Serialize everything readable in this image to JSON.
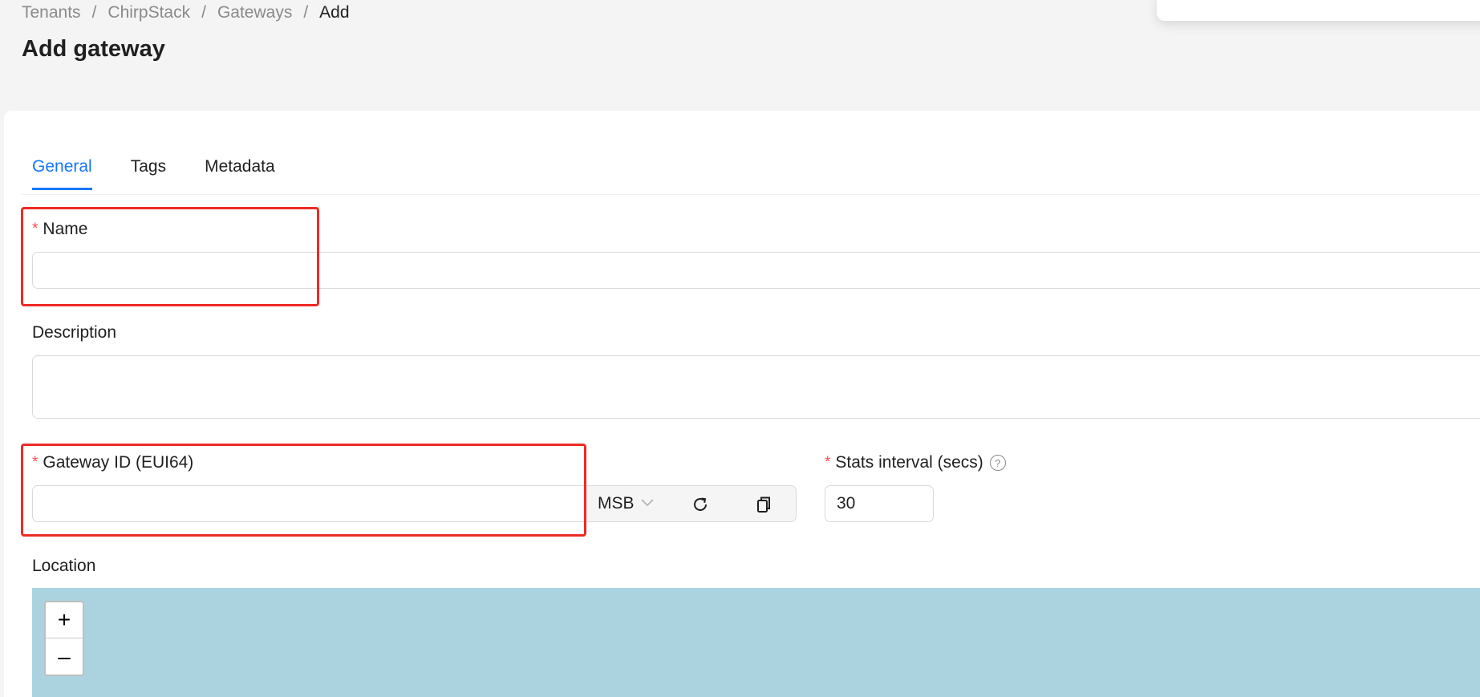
{
  "breadcrumb": {
    "items": [
      "Tenants",
      "ChirpStack",
      "Gateways",
      "Add"
    ],
    "separator": "/"
  },
  "page": {
    "title": "Add gateway"
  },
  "tabs": [
    {
      "label": "General",
      "active": true
    },
    {
      "label": "Tags",
      "active": false
    },
    {
      "label": "Metadata",
      "active": false
    }
  ],
  "form": {
    "name": {
      "label": "Name",
      "required": true,
      "value": "",
      "placeholder": ""
    },
    "description": {
      "label": "Description",
      "value": "",
      "placeholder": ""
    },
    "gateway_id": {
      "label": "Gateway ID (EUI64)",
      "required": true,
      "value": "",
      "placeholder": "",
      "byte_order": "MSB",
      "regenerate_icon": "refresh-icon",
      "copy_icon": "copy-icon"
    },
    "stats_interval": {
      "label": "Stats interval (secs)",
      "required": true,
      "value": "30",
      "help_icon": "question-circle-icon",
      "help_glyph": "?"
    },
    "location": {
      "label": "Location",
      "zoom_in": "+",
      "zoom_out": "–"
    }
  },
  "colors": {
    "accent": "#1677ff",
    "required": "#ff4d4f",
    "highlight": "#ee2b24",
    "map_water": "#aad3df"
  }
}
